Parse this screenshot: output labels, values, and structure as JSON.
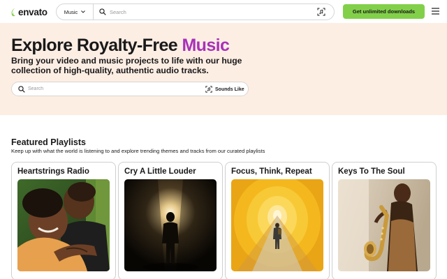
{
  "brand": {
    "name": "envato",
    "color": "#82d04a"
  },
  "header": {
    "category": "Music",
    "search_placeholder": "Search",
    "cta_label": "Get unlimited downloads",
    "cta_color": "#82d04a",
    "icons": [
      "envato-logo-icon",
      "chevron-down-icon",
      "search-icon",
      "audio-match-icon",
      "menu-icon"
    ]
  },
  "hero": {
    "title_prefix": "Explore Royalty-Free",
    "title_accent": "Music",
    "accent_color": "#a832b8",
    "background_color": "#fdeee4",
    "subtitle": "Bring your video and music projects to life with our huge collection of high-quality, authentic audio tracks.",
    "search_placeholder": "Search",
    "sounds_like_label": "Sounds Like"
  },
  "featured": {
    "title": "Featured Playlists",
    "description": "Keep up with what the world is listening to and explore trending themes and tracks from our curated playlists",
    "playlists": [
      {
        "title": "Heartstrings Radio",
        "image": "embracing-couple-photo"
      },
      {
        "title": "Cry A Little Louder",
        "image": "silhouette-in-light-tunnel-photo"
      },
      {
        "title": "Focus, Think, Repeat",
        "image": "figure-in-yellow-tunnel-photo"
      },
      {
        "title": "Keys To The Soul",
        "image": "saxophone-player-photo"
      }
    ]
  }
}
